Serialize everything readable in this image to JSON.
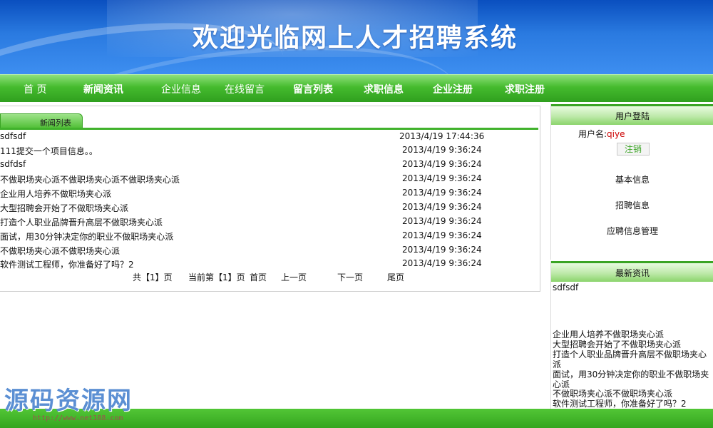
{
  "banner": {
    "title": "欢迎光临网上人才招聘系统"
  },
  "nav": {
    "items": [
      {
        "label": "首 页"
      },
      {
        "label": "新闻资讯"
      },
      {
        "label": "企业信息"
      },
      {
        "label": "在线留言"
      },
      {
        "label": "留言列表"
      },
      {
        "label": "求职信息"
      },
      {
        "label": "企业注册"
      },
      {
        "label": "求职注册"
      }
    ]
  },
  "news": {
    "tab_label": "新闻列表",
    "rows": [
      {
        "title": "sdfsdf",
        "date": "2013/4/19 17:44:36"
      },
      {
        "title": "111提交一个项目信息。。",
        "date": "2013/4/19 9:36:24"
      },
      {
        "title": "sdfdsf",
        "date": "2013/4/19 9:36:24"
      },
      {
        "title": "不做职场夹心派不做职场夹心派不做职场夹心派",
        "date": "2013/4/19 9:36:24"
      },
      {
        "title": "企业用人培养不做职场夹心派",
        "date": "2013/4/19 9:36:24"
      },
      {
        "title": "大型招聘会开始了不做职场夹心派",
        "date": "2013/4/19 9:36:24"
      },
      {
        "title": "打造个人职业品牌晋升高层不做职场夹心派",
        "date": "2013/4/19 9:36:24"
      },
      {
        "title": "面试，用30分钟决定你的职业不做职场夹心派",
        "date": "2013/4/19 9:36:24"
      },
      {
        "title": "不做职场夹心派不做职场夹心派",
        "date": "2013/4/19 9:36:24"
      },
      {
        "title": "软件测试工程师，你准备好了吗？2",
        "date": "2013/4/19 9:36:24"
      }
    ],
    "pager": {
      "total": "共【1】页",
      "current": "当前第【1】页",
      "first": "首页",
      "prev": "上一页",
      "next": "下一页",
      "last": "尾页"
    }
  },
  "login": {
    "header": "用户登陆",
    "user_label": "用户名:",
    "user_name": "qiye",
    "logout": "注销",
    "links": [
      "基本信息",
      "招聘信息",
      "应聘信息管理"
    ]
  },
  "latest": {
    "header": "最新资讯",
    "items": [
      "sdfsdf",
      "企业用人培养不做职场夹心派",
      "大型招聘会开始了不做职场夹心派",
      "打造个人职业品牌晋升高层不做职场夹心派",
      "面试，用30分钟决定你的职业不做职场夹心派",
      "不做职场夹心派不做职场夹心派",
      "软件测试工程师，你准备好了吗？2"
    ]
  },
  "watermark": {
    "text": "源码资源网",
    "url": "http://www.net188.com"
  },
  "colors": {
    "banner_blue": "#1f6fd6",
    "nav_green": "#45bb2e",
    "accent_red": "#cc0000"
  }
}
